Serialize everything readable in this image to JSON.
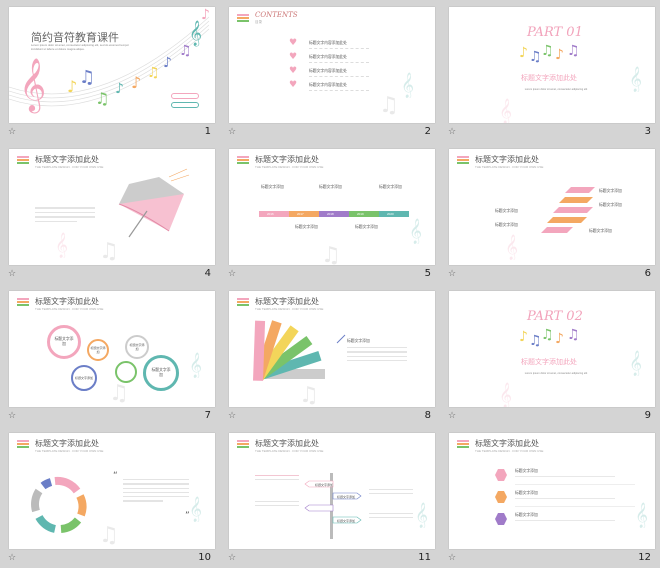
{
  "colors": {
    "pink": "#f3a6bd",
    "orange": "#f4a862",
    "yellow": "#f3d55a",
    "green": "#7ac36a",
    "teal": "#5fb7b0",
    "blue": "#6b7ec7",
    "purple": "#a07bc9",
    "gray": "#a0a0a0"
  },
  "slide_numbers": [
    "1",
    "2",
    "3",
    "4",
    "5",
    "6",
    "7",
    "8",
    "9",
    "10",
    "11",
    "12"
  ],
  "slide1": {
    "title": "简约音符教育课件",
    "desc1": "Lorem ipsum dolor sit amet, consectetur adipiscing elit, sed do eiusmod tempor",
    "desc2": "incididunt ut labore et dolore magna aliqua."
  },
  "slide2": {
    "title": "CONTENTS",
    "subtitle": "目录",
    "items": [
      "标题文字内容添加此处",
      "标题文字内容添加此处",
      "标题文字内容添加此处",
      "标题文字内容添加此处"
    ]
  },
  "slide3": {
    "part": "PART 01",
    "title": "标题文字添加此处",
    "desc": "Lorem ipsum dolor sit amet, consectetur adipiscing elit"
  },
  "slide_header": {
    "title": "标题文字添加此处",
    "subtitle": "THE TEMPLATE DESIGN · FOR YOUR OWN USE"
  },
  "slide5": {
    "labels": [
      "标题文字添加",
      "标题文字添加",
      "标题文字添加",
      "标题文字添加",
      "标题文字添加"
    ],
    "years": [
      "2016",
      "2017",
      "2018",
      "2019",
      "2020"
    ]
  },
  "slide6": {
    "labels": [
      "标题文字添加",
      "标题文字添加",
      "标题文字添加",
      "标题文字添加"
    ],
    "body_title": "标题文字添加"
  },
  "slide7": {
    "circles": [
      "标题文字添加",
      "标题文字添加",
      "标题文字添加",
      "标题文字添加",
      "标题文字添加"
    ]
  },
  "slide8": {
    "body_title": "标题文字添加"
  },
  "slide9": {
    "part": "PART 02",
    "title": "标题文字添加此处",
    "desc": "Lorem ipsum dolor sit amet, consectetur adipiscing elit"
  },
  "slide11": {
    "signs": [
      "标题文字添加",
      "标题文字添加",
      "标题文字添加"
    ]
  },
  "slide12": {
    "items": [
      "标题文字添加",
      "标题文字添加",
      "标题文字添加"
    ]
  },
  "icons": {
    "footer": "star-slide-icon",
    "note": "music-note-icon"
  }
}
